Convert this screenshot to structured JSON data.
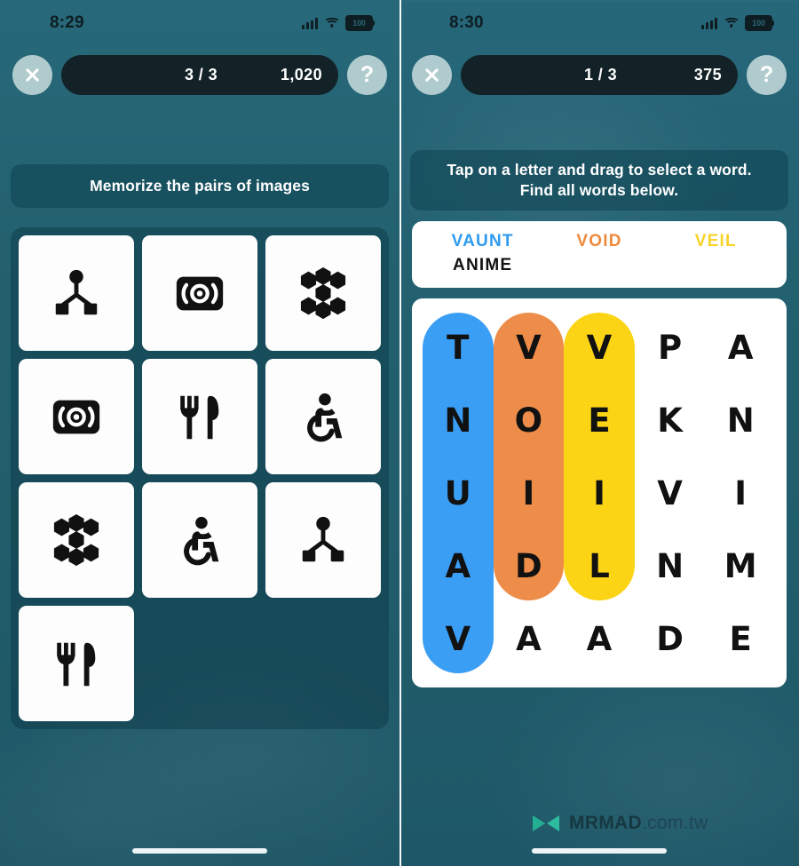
{
  "left": {
    "status": {
      "time": "8:29",
      "battery": "100",
      "signal_icon": "cellular-bars-icon",
      "wifi_icon": "wifi-icon",
      "battery_icon": "battery-icon"
    },
    "topbar": {
      "close_label": "close-icon",
      "progress": "3 / 3",
      "points": "1,020",
      "help_label": "?"
    },
    "banner": "Memorize the pairs of images",
    "tiles": [
      {
        "icon": "hierarchy-node-icon"
      },
      {
        "icon": "airplay-speaker-icon"
      },
      {
        "icon": "hexagon-cluster-icon"
      },
      {
        "icon": "airplay-speaker-icon"
      },
      {
        "icon": "fork-knife-icon"
      },
      {
        "icon": "wheelchair-accessibility-icon"
      },
      {
        "icon": "hexagon-cluster-icon"
      },
      {
        "icon": "wheelchair-accessibility-icon"
      },
      {
        "icon": "hierarchy-node-icon"
      },
      {
        "icon": "fork-knife-icon"
      }
    ]
  },
  "right": {
    "status": {
      "time": "8:30",
      "battery": "100",
      "signal_icon": "cellular-bars-icon",
      "wifi_icon": "wifi-icon",
      "battery_icon": "battery-icon"
    },
    "topbar": {
      "close_label": "close-icon",
      "progress": "1 / 3",
      "points": "375",
      "help_label": "?"
    },
    "banner_line1": "Tap on a letter and drag to select a word.",
    "banner_line2": "Find all words below.",
    "words": [
      {
        "text": "VAUNT",
        "color": "#2f9bf0",
        "found": true
      },
      {
        "text": "VOID",
        "color": "#ef8a3c",
        "found": true
      },
      {
        "text": "VEIL",
        "color": "#f7d32a",
        "found": true
      },
      {
        "text": "ANIME",
        "color": "#111111",
        "found": false
      }
    ],
    "grid": {
      "rows": 5,
      "cols": 5,
      "letters": [
        [
          "T",
          "V",
          "V",
          "P",
          "A"
        ],
        [
          "N",
          "O",
          "E",
          "K",
          "N"
        ],
        [
          "U",
          "I",
          "I",
          "V",
          "I"
        ],
        [
          "A",
          "D",
          "L",
          "N",
          "M"
        ],
        [
          "V",
          "A",
          "A",
          "D",
          "E"
        ]
      ],
      "highlights": [
        {
          "word": "VAUNT",
          "color": "#3b9ef5",
          "col": 0,
          "row_start": 0,
          "row_end": 4
        },
        {
          "word": "VOID",
          "color": "#ee8c4a",
          "col": 1,
          "row_start": 0,
          "row_end": 3
        },
        {
          "word": "VEIL",
          "color": "#fcd416",
          "col": 2,
          "row_start": 0,
          "row_end": 3
        }
      ]
    }
  },
  "watermark": {
    "brand": "MRMAD",
    "suffix": ".com.tw",
    "logo": "mrmad-butterfly-logo"
  },
  "colors": {
    "background_teal": "#236070",
    "pill_dark": "#132227",
    "banner_bg": "#104654",
    "tile_white": "#fdfdfd",
    "blue": "#3b9ef5",
    "orange": "#ee8c4a",
    "yellow": "#fcd416"
  }
}
